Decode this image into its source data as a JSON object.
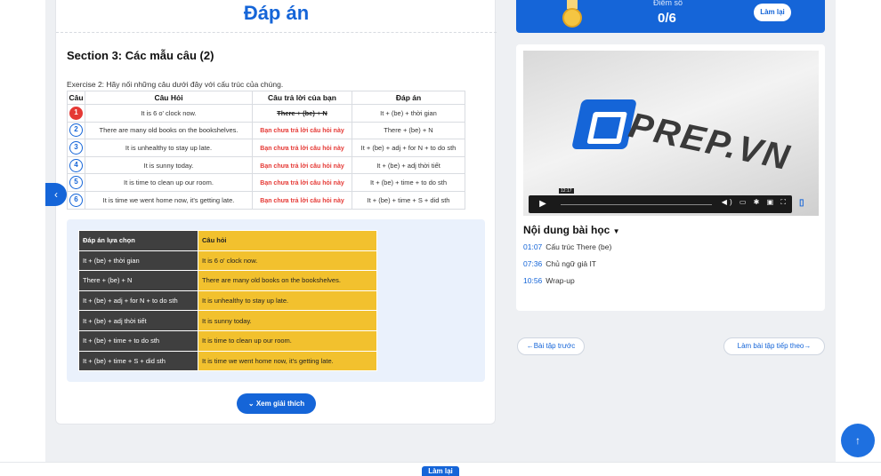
{
  "header": {
    "answer_title": "Đáp án"
  },
  "section": {
    "title": "Section 3: Các mẫu câu (2)",
    "exercise": "Exercise 2: Hãy nối những câu dưới đây với cấu trúc của chúng."
  },
  "question_table": {
    "headers": [
      "Câu",
      "Câu Hỏi",
      "Câu trả lời của bạn",
      "Đáp án"
    ],
    "rows": [
      {
        "num": "1",
        "status": "wrong",
        "question": "It is 6 o' clock now.",
        "your_answer": "There + (be) + N",
        "answer": "It + (be) + thời gian"
      },
      {
        "num": "2",
        "status": "unanswered",
        "question": "There are many old books on the bookshelves.",
        "your_answer": "Bạn chưa trả lời câu hỏi này",
        "answer": "There + (be) + N"
      },
      {
        "num": "3",
        "status": "unanswered",
        "question": "It is unhealthy to stay up late.",
        "your_answer": "Bạn chưa trả lời câu hỏi này",
        "answer": "It + (be) + adj + for N + to do sth"
      },
      {
        "num": "4",
        "status": "unanswered",
        "question": "It is sunny today.",
        "your_answer": "Bạn chưa trả lời câu hỏi này",
        "answer": "It + (be) + adj thời tiết"
      },
      {
        "num": "5",
        "status": "unanswered",
        "question": "It is time to clean up our room.",
        "your_answer": "Bạn chưa trả lời câu hỏi này",
        "answer": "It + (be) + time + to do sth"
      },
      {
        "num": "6",
        "status": "unanswered",
        "question": "It is time we went home now, it's getting late.",
        "your_answer": "Bạn chưa trả lời câu hỏi này",
        "answer": "It + (be) + time + S + did sth"
      }
    ]
  },
  "match_table": {
    "headers": [
      "Đáp án lựa chọn",
      "Câu hỏi"
    ],
    "rows": [
      [
        "It + (be) + thời gian",
        "It is 6 o' clock now."
      ],
      [
        "There + (be) + N",
        "There are many old books on the bookshelves."
      ],
      [
        "It + (be) + adj + for N + to do sth",
        "It is unhealthy to stay up late."
      ],
      [
        "It + (be) + adj thời tiết",
        "It is sunny today."
      ],
      [
        "It + (be) + time + to do sth",
        "It is time to clean up our room."
      ],
      [
        "It + (be) + time + S + did sth",
        "It is time we went home now, it's getting late."
      ]
    ]
  },
  "explain_button": "Xem giải thích",
  "score": {
    "label": "Điểm số",
    "value": "0/6",
    "retry": "Làm lại"
  },
  "video": {
    "logo": "PREP.VN",
    "timestamp": "12:17"
  },
  "lesson": {
    "title": "Nội dung bài học",
    "items": [
      {
        "time": "01:07",
        "label": "Cấu trúc There (be)"
      },
      {
        "time": "07:36",
        "label": "Chủ ngữ giả IT"
      },
      {
        "time": "10:56",
        "label": "Wrap-up"
      }
    ]
  },
  "nav": {
    "prev": "Bài tập trước",
    "next": "Làm bài tập tiếp theo"
  },
  "bottom": {
    "button": "Làm lại"
  },
  "colors": {
    "primary": "#1565d8",
    "wrong": "#e53935",
    "match_dark": "#3f3f3f",
    "match_yellow": "#f2c12e"
  }
}
